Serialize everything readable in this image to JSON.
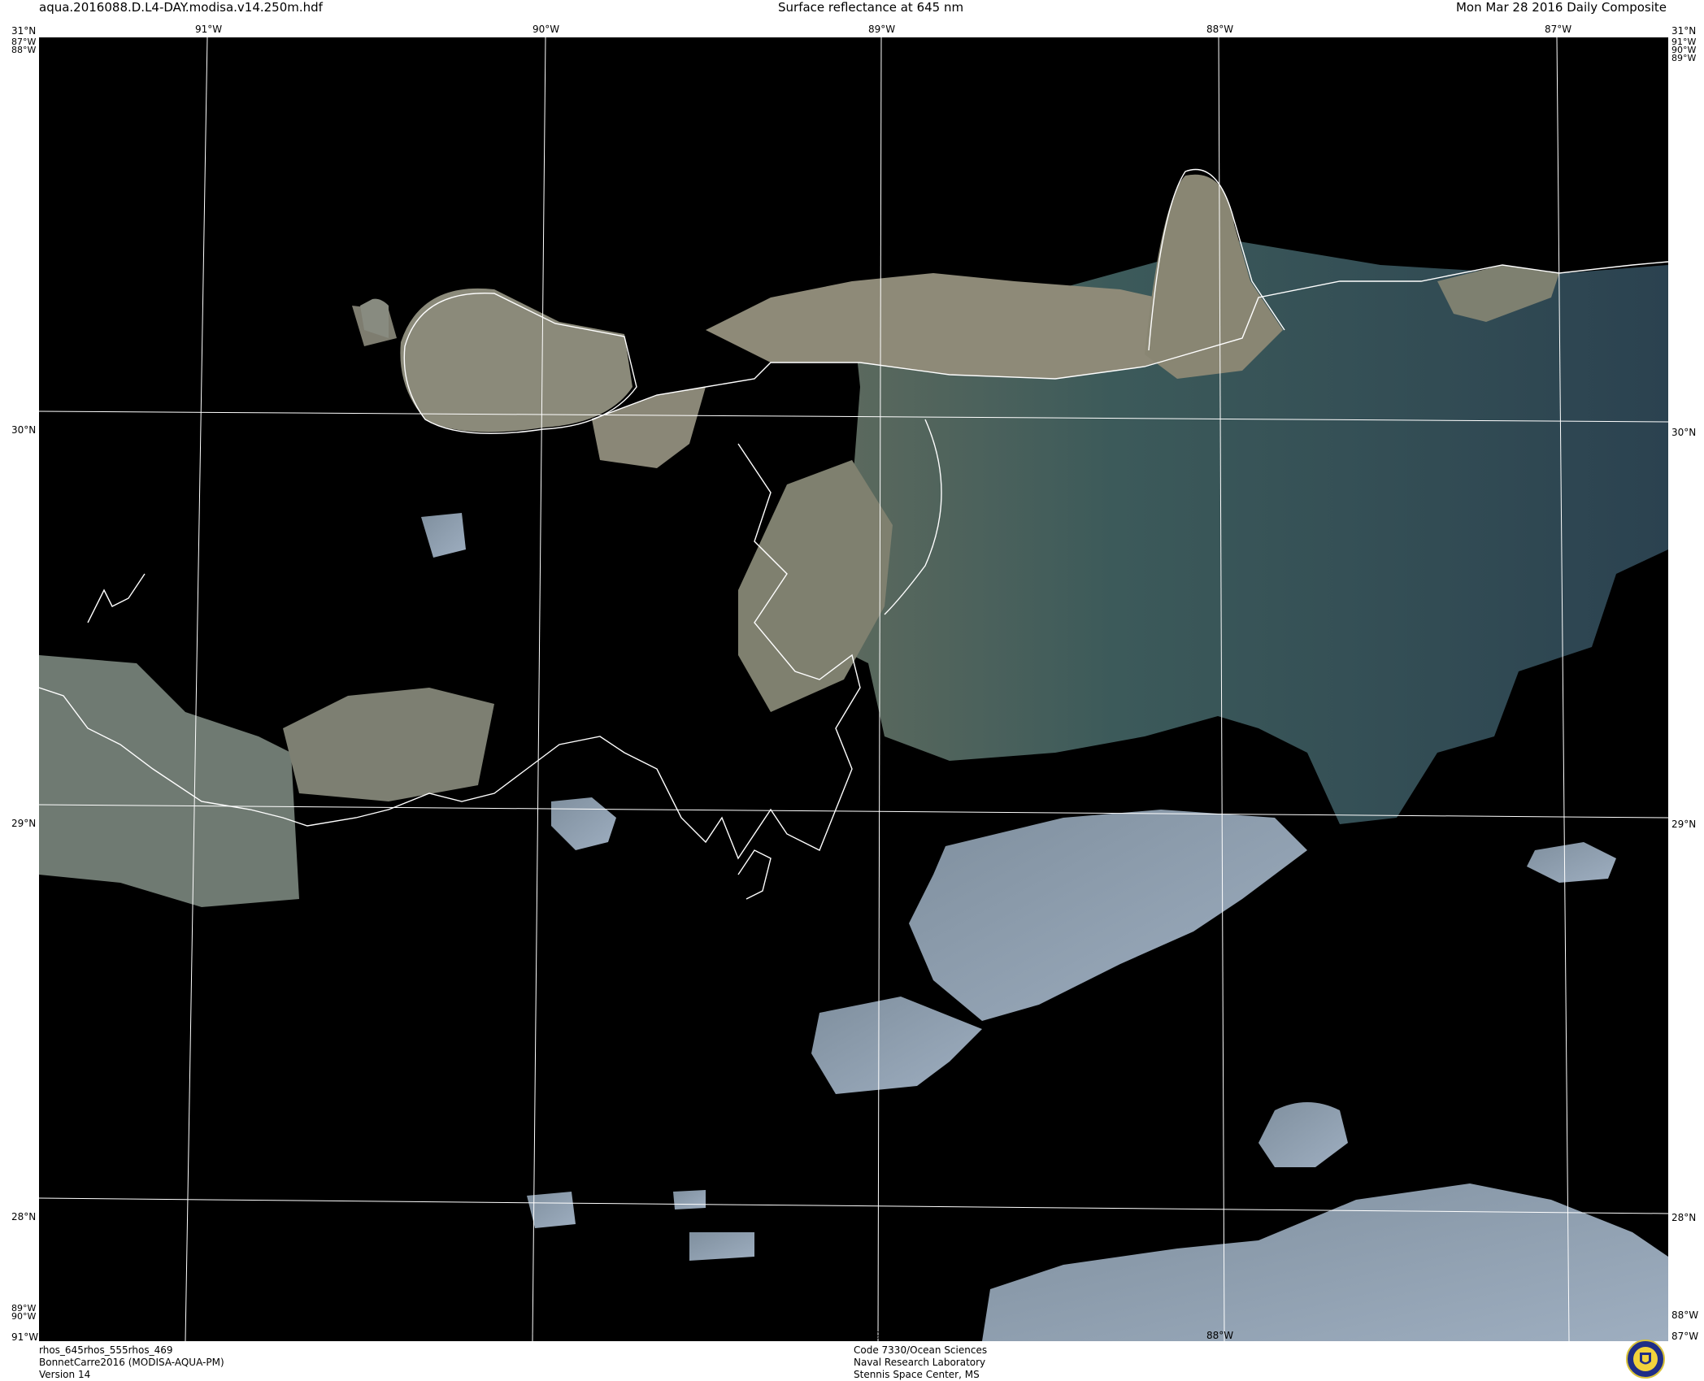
{
  "header": {
    "filename": "aqua.2016088.D.L4-DAY.modisa.v14.250m.hdf",
    "product_title": "Surface reflectance at 645 nm",
    "date_label": "Mon Mar 28 2016 Daily Composite"
  },
  "map": {
    "top_labels": [
      "91°W",
      "90°W",
      "89°W",
      "88°W",
      "87°W"
    ],
    "bottom_labels": [
      "90°W",
      "89°W",
      "88°W"
    ],
    "left_labels": [
      "30°N",
      "29°N",
      "28°N"
    ],
    "right_labels": [
      "30°N",
      "29°N",
      "28°N"
    ],
    "corner_labels": {
      "top_left_1": "31°N",
      "top_left_2": "87°W",
      "top_left_3": "88°W",
      "top_right_1": "31°N",
      "top_right_2": "91°W",
      "top_right_3": "90°W",
      "top_right_4": "89°W",
      "bottom_left_1": "89°W",
      "bottom_left_2": "90°W",
      "bottom_left_3": "91°W",
      "bottom_right_1": "88°W",
      "bottom_right_2": "87°W"
    },
    "colors": {
      "background": "#000000",
      "grid": "#ffffff",
      "coastline": "#ffffff",
      "turbid_water": "#938b7c",
      "clear_water": "#2c4550",
      "cloud": "#8b9cae"
    }
  },
  "footer": {
    "left_line1": "rhos_645rhos_555rhos_469",
    "left_line2": "BonnetCarre2016 (MODISA-AQUA-PM)",
    "left_line3": "Version 14",
    "center_line1": "Code 7330/Ocean Sciences",
    "center_line2": "Naval Research Laboratory",
    "center_line3": "Stennis Space Center, MS",
    "logo_icon": "nrl-seal-icon"
  }
}
